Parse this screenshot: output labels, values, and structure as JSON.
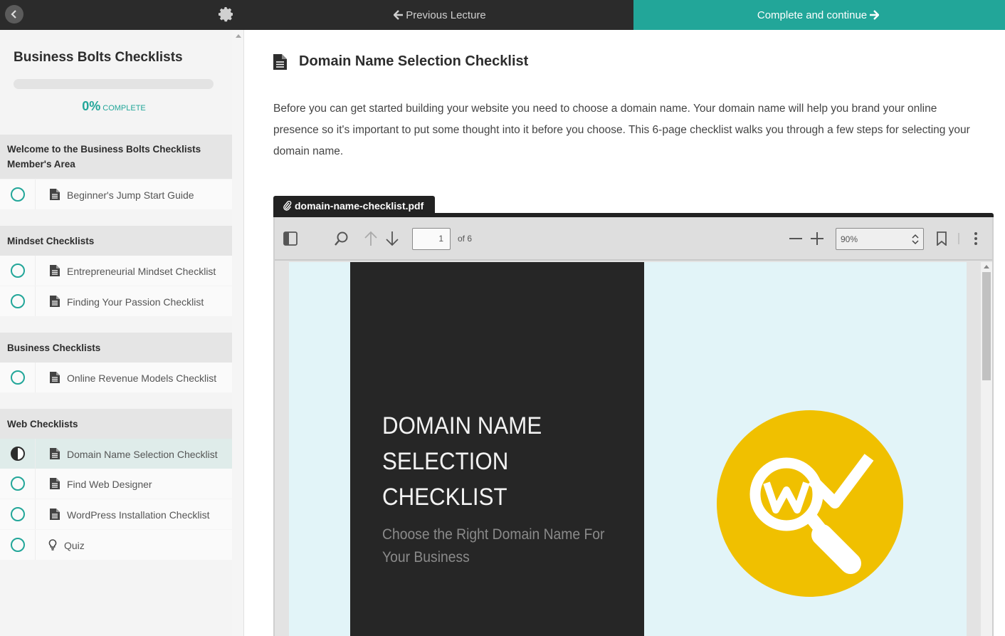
{
  "topbar": {
    "back_icon": "chevron-left-icon",
    "settings_icon": "gear-icon",
    "prev_label": "Previous Lecture",
    "next_label": "Complete and continue",
    "accent_color": "#22a699"
  },
  "sidebar": {
    "course_title": "Business Bolts Checklists",
    "progress_percent": "0%",
    "progress_label": "COMPLETE",
    "progress_value": 0,
    "sections": [
      {
        "title": "Welcome to the Business Bolts Checklists Member's Area",
        "lectures": [
          {
            "label": "Beginner's Jump Start Guide",
            "icon": "document-icon",
            "status": "incomplete"
          }
        ]
      },
      {
        "title": "Mindset Checklists",
        "lectures": [
          {
            "label": "Entrepreneurial Mindset Checklist",
            "icon": "document-icon",
            "status": "incomplete"
          },
          {
            "label": "Finding Your Passion Checklist",
            "icon": "document-icon",
            "status": "incomplete"
          }
        ]
      },
      {
        "title": "Business Checklists",
        "lectures": [
          {
            "label": "Online Revenue Models Checklist",
            "icon": "document-icon",
            "status": "incomplete"
          }
        ]
      },
      {
        "title": "Web Checklists",
        "lectures": [
          {
            "label": "Domain Name Selection Checklist",
            "icon": "document-icon",
            "status": "in-progress"
          },
          {
            "label": "Find Web Designer",
            "icon": "document-icon",
            "status": "incomplete"
          },
          {
            "label": "WordPress Installation Checklist",
            "icon": "document-icon",
            "status": "incomplete"
          },
          {
            "label": "Quiz",
            "icon": "lightbulb-icon",
            "status": "incomplete"
          }
        ]
      }
    ]
  },
  "main": {
    "title": "Domain Name Selection Checklist",
    "title_icon": "document-icon",
    "description": "Before you can get started building your website you need to choose a domain name. Your domain name will help you brand your online presence so it's important to put some thought into it before you choose. This 6-page checklist walks you through a few steps for selecting your domain name.",
    "attachment": {
      "filename": "domain-name-checklist.pdf",
      "icon": "paperclip-icon"
    },
    "pdf_viewer": {
      "page_current": "1",
      "page_total_label": "of 6",
      "zoom": "90%",
      "page_title_lines": [
        "DOMAIN NAME",
        "SELECTION",
        "CHECKLIST"
      ],
      "page_subtitle": "Choose the Right Domain Name For Your Business",
      "logo": "magnifier-checkmark-logo",
      "logo_color": "#f0c000"
    }
  }
}
